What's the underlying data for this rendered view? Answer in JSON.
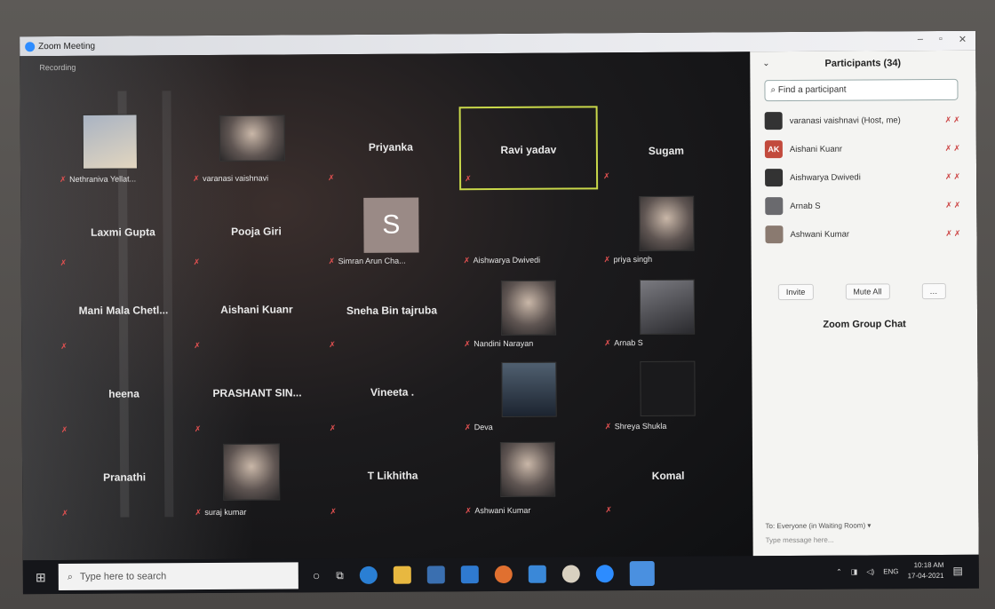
{
  "window": {
    "title": "Zoom Meeting",
    "recording_label": "Recording"
  },
  "gallery": [
    {
      "name": "",
      "label": "Nethraniva Yellat...",
      "type": "photo"
    },
    {
      "name": "",
      "label": "varanasi vaishnavi",
      "type": "photo"
    },
    {
      "name": "Priyanka",
      "label": "",
      "type": "name"
    },
    {
      "name": "Ravi yadav",
      "label": "",
      "type": "name",
      "active": true
    },
    {
      "name": "Sugam",
      "label": "",
      "type": "name"
    },
    {
      "name": "Laxmi Gupta",
      "label": "",
      "type": "name"
    },
    {
      "name": "Pooja Giri",
      "label": "",
      "type": "name"
    },
    {
      "name": "S",
      "label": "Simran Arun Cha...",
      "type": "avatar"
    },
    {
      "name": "",
      "label": "Aishwarya Dwivedi",
      "type": "label"
    },
    {
      "name": "",
      "label": "priya singh",
      "type": "photo"
    },
    {
      "name": "Mani Mala Chetl...",
      "label": "",
      "type": "name"
    },
    {
      "name": "Aishani Kuanr",
      "label": "",
      "type": "name"
    },
    {
      "name": "Sneha Bin tajruba",
      "label": "",
      "type": "name"
    },
    {
      "name": "",
      "label": "Nandini Narayan",
      "type": "photo"
    },
    {
      "name": "",
      "label": "Arnab S",
      "type": "photo"
    },
    {
      "name": "heena",
      "label": "",
      "type": "name"
    },
    {
      "name": "PRASHANT SIN...",
      "label": "",
      "type": "name"
    },
    {
      "name": "Vineeta .",
      "label": "",
      "type": "name"
    },
    {
      "name": "",
      "label": "Deva",
      "type": "photo"
    },
    {
      "name": "",
      "label": "Shreya Shukla",
      "type": "photo"
    },
    {
      "name": "Pranathi",
      "label": "",
      "type": "name"
    },
    {
      "name": "",
      "label": "suraj kumar",
      "type": "photo"
    },
    {
      "name": "T Likhitha",
      "label": "",
      "type": "name"
    },
    {
      "name": "",
      "label": "Ashwani Kumar",
      "type": "photo"
    },
    {
      "name": "Komal",
      "label": "",
      "type": "name"
    }
  ],
  "participants": {
    "title": "Participants (34)",
    "search_placeholder": "Find a participant",
    "list": [
      {
        "name": "varanasi vaishnavi (Host, me)",
        "initials": ""
      },
      {
        "name": "Aishani Kuanr",
        "initials": "AK"
      },
      {
        "name": "Aishwarya Dwivedi",
        "initials": ""
      },
      {
        "name": "Arnab S",
        "initials": ""
      },
      {
        "name": "Ashwani Kumar",
        "initials": ""
      }
    ],
    "invite_label": "Invite",
    "mute_all_label": "Mute All"
  },
  "chat": {
    "title": "Zoom Group Chat",
    "to_label": "To:  Everyone (in Waiting Room) ▾",
    "input_placeholder": "Type message here..."
  },
  "taskbar": {
    "search_placeholder": "Type here to search",
    "language": "ENG",
    "time": "10:18 AM",
    "date": "17-04-2021"
  }
}
